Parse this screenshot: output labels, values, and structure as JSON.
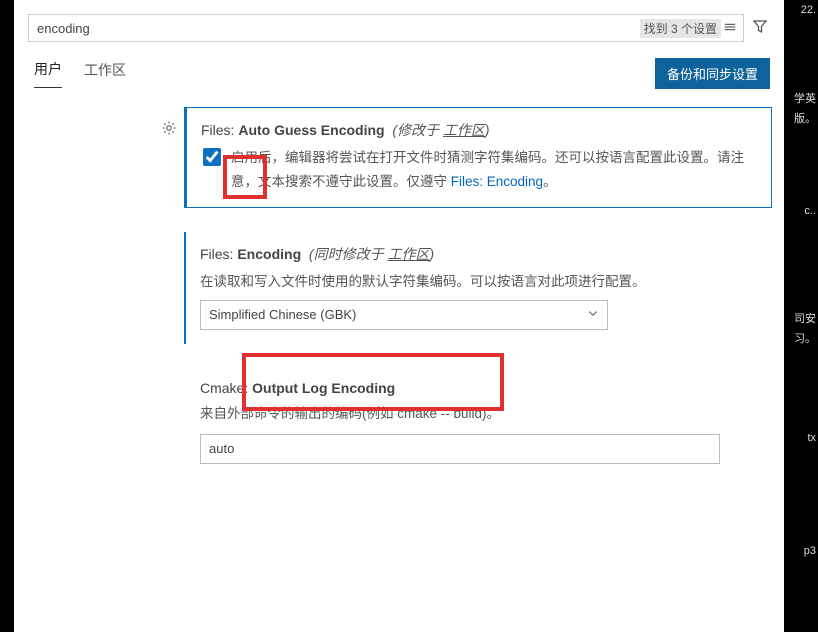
{
  "search": {
    "value": "encoding",
    "found_label": "找到 3 个设置"
  },
  "tabs": {
    "user": "用户",
    "workspace": "工作区"
  },
  "sync_button": "备份和同步设置",
  "settings": {
    "autoGuess": {
      "title_prefix": "Files: ",
      "title_bold": "Auto Guess Encoding",
      "modified_prefix": "(修改于 ",
      "modified_link": "工作区",
      "modified_suffix": ")",
      "desc_part1": "启用后，编辑器将尝试在打开文件时猜测字符集编码。还可以按语言配置此设置。请注意，文本搜索不遵守此设置。仅遵守 ",
      "desc_link": "Files: Encoding",
      "desc_suffix": "。",
      "checked": true
    },
    "encoding": {
      "title_prefix": "Files: ",
      "title_bold": "Encoding",
      "modified_prefix": "(同时修改于 ",
      "modified_link": "工作区",
      "modified_suffix": ")",
      "desc": "在读取和写入文件时使用的默认字符集编码。可以按语言对此项进行配置。",
      "value": "Simplified Chinese (GBK)"
    },
    "cmake": {
      "title_prefix": "Cmake: ",
      "title_bold": "Output Log Encoding",
      "desc": "来自外部命令的输出的编码(例如 cmake -- build)。",
      "value": "auto"
    }
  },
  "side": {
    "a": "22.",
    "b": "学英",
    "c": "版。",
    "d": "c..",
    "e": "司安",
    "f": "习。",
    "g": "tx",
    "h": "p3"
  }
}
